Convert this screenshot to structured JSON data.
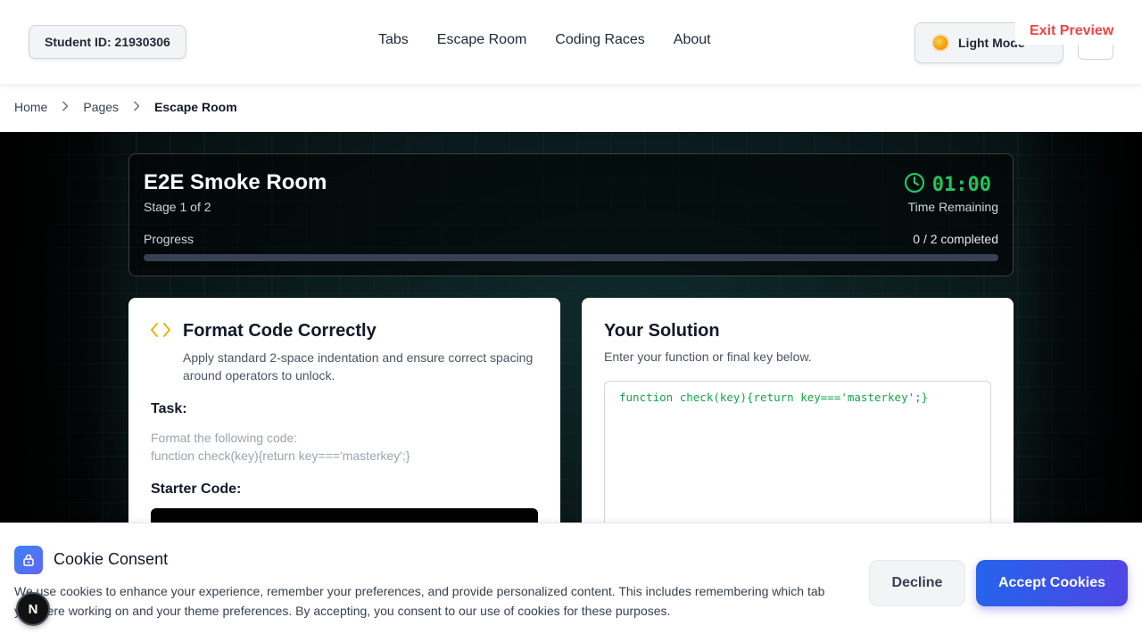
{
  "header": {
    "student_id": "Student ID: 21930306",
    "nav": [
      "Tabs",
      "Escape Room",
      "Coding Races",
      "About"
    ],
    "theme_label": "Light Mode",
    "exit_preview": "Exit Preview"
  },
  "breadcrumb": {
    "items": [
      "Home",
      "Pages",
      "Escape Room"
    ]
  },
  "room": {
    "title": "E2E Smoke Room",
    "stage": "Stage 1 of 2",
    "timer": "01:00",
    "time_remaining_label": "Time Remaining",
    "progress_label": "Progress",
    "progress_count": "0 / 2 completed",
    "progress_fraction": 0,
    "timer_color": "#22c55e"
  },
  "task": {
    "title": "Format Code Correctly",
    "description": "Apply standard 2-space indentation and ensure correct spacing around operators to unlock.",
    "task_heading": "Task:",
    "task_line1": "Format the following code:",
    "task_line2": "function check(key){return key==='masterkey';}",
    "starter_heading": "Starter Code:",
    "icon": "code-icon"
  },
  "solution": {
    "title": "Your Solution",
    "description": "Enter your function or final key below.",
    "value": "function check(key){return key==='masterkey';}"
  },
  "cookie": {
    "title": "Cookie Consent",
    "text": "We use cookies to enhance your experience, remember your preferences, and provide personalized content. This includes remembering which tab you were working on and your theme preferences. By accepting, you consent to our use of cookies for these purposes.",
    "decline": "Decline",
    "accept": "Accept Cookies"
  },
  "badge": {
    "letter": "N"
  },
  "colors": {
    "accent": "#4f46e5",
    "danger": "#ef4444",
    "success": "#22c55e",
    "code_icon": "#eab308"
  }
}
